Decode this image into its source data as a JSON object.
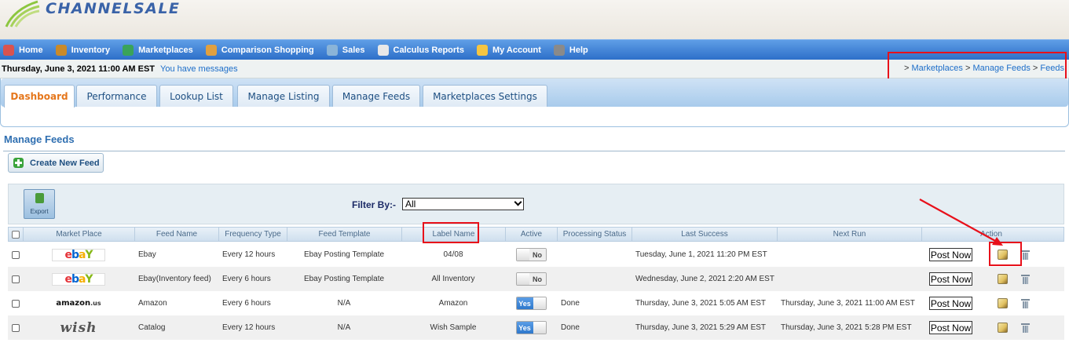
{
  "app": {
    "logo_text": "CHANNELSALE"
  },
  "nav": {
    "items": [
      {
        "label": "Home",
        "icon": "home-icon",
        "color": "#d9534f"
      },
      {
        "label": "Inventory",
        "icon": "inventory-icon",
        "color": "#c98a2a"
      },
      {
        "label": "Marketplaces",
        "icon": "globe-icon",
        "color": "#3aa35a"
      },
      {
        "label": "Comparison Shopping",
        "icon": "folder-icon",
        "color": "#e0a040"
      },
      {
        "label": "Sales",
        "icon": "sales-icon",
        "color": "#8ab4d8"
      },
      {
        "label": "Calculus Reports",
        "icon": "chart-icon",
        "color": "#e8e8e8"
      },
      {
        "label": "My Account",
        "icon": "account-icon",
        "color": "#f5c542"
      },
      {
        "label": "Help",
        "icon": "help-icon",
        "color": "#8a8a8a"
      }
    ]
  },
  "info": {
    "date": "Thursday, June 3, 2021 11:00 AM EST",
    "messages": "You have messages"
  },
  "breadcrumb": {
    "sep": ">",
    "items": [
      "Marketplaces",
      "Manage Feeds",
      "Feeds"
    ]
  },
  "tabs": [
    {
      "label": "Dashboard",
      "active": true
    },
    {
      "label": "Performance"
    },
    {
      "label": "Lookup List"
    },
    {
      "label": "Manage Listing"
    },
    {
      "label": "Manage Feeds"
    },
    {
      "label": "Marketplaces Settings"
    }
  ],
  "section": {
    "title": "Manage Feeds",
    "create_button": "Create New Feed"
  },
  "toolbar": {
    "export_label": "Export",
    "filter_label": "Filter By:-",
    "filter_value": "All"
  },
  "table": {
    "headers": [
      "Market Place",
      "Feed Name",
      "Frequency Type",
      "Feed Template",
      "Label Name",
      "Active",
      "Processing Status",
      "Last Success",
      "Next Run",
      "Action"
    ],
    "rows": [
      {
        "market": "ebay",
        "feed_name": "Ebay",
        "frequency": "Every 12 hours",
        "template": "Ebay Posting Template",
        "label": "04/08",
        "active": "No",
        "status": "",
        "last_success": "Tuesday, June 1, 2021 11:20 PM EST",
        "next_run": "",
        "post": "Post Now"
      },
      {
        "market": "ebay",
        "feed_name": "Ebay(Inventory feed)",
        "frequency": "Every 6 hours",
        "template": "Ebay Posting Template",
        "label": "All Inventory",
        "active": "No",
        "status": "",
        "last_success": "Wednesday, June 2, 2021 2:20 AM EST",
        "next_run": "",
        "post": "Post Now"
      },
      {
        "market": "amazon",
        "feed_name": "Amazon",
        "frequency": "Every 6 hours",
        "template": "N/A",
        "label": "Amazon",
        "active": "Yes",
        "status": "Done",
        "last_success": "Thursday, June 3, 2021 5:05 AM EST",
        "next_run": "Thursday, June 3, 2021 11:00 AM EST",
        "post": "Post Now"
      },
      {
        "market": "wish",
        "feed_name": "Catalog",
        "frequency": "Every 12 hours",
        "template": "N/A",
        "label": "Wish Sample",
        "active": "Yes",
        "status": "Done",
        "last_success": "Thursday, June 3, 2021 5:29 AM EST",
        "next_run": "Thursday, June 3, 2021 5:28 PM EST",
        "post": "Post Now"
      }
    ]
  },
  "logos": {
    "ebay": [
      "e",
      "b",
      "a",
      "Y"
    ],
    "amazon_main": "amazon",
    "amazon_suffix": ".us",
    "wish": "wish"
  },
  "colors": {
    "nav_blue": "#2d6fc9",
    "highlight_red": "#e8101a",
    "active_tab": "#e5761b"
  }
}
